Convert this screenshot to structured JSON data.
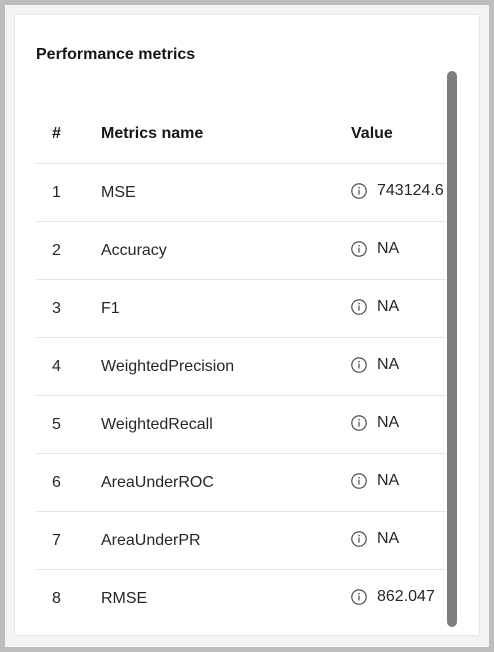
{
  "card": {
    "title": "Performance metrics"
  },
  "table": {
    "headers": {
      "number": "#",
      "name": "Metrics name",
      "value": "Value"
    },
    "rows": [
      {
        "number": "1",
        "name": "MSE",
        "value": "743124.6"
      },
      {
        "number": "2",
        "name": "Accuracy",
        "value": "NA"
      },
      {
        "number": "3",
        "name": "F1",
        "value": "NA"
      },
      {
        "number": "4",
        "name": "WeightedPrecision",
        "value": "NA"
      },
      {
        "number": "5",
        "name": "WeightedRecall",
        "value": "NA"
      },
      {
        "number": "6",
        "name": "AreaUnderROC",
        "value": "NA"
      },
      {
        "number": "7",
        "name": "AreaUnderPR",
        "value": "NA"
      },
      {
        "number": "8",
        "name": "RMSE",
        "value": "862.047"
      }
    ],
    "value_icon": "info-icon"
  },
  "colors": {
    "background": "#f4f4f4",
    "card": "#ffffff",
    "divider": "#e5e5e5",
    "scrollbar": "#7d7d7d",
    "text": "#161616"
  }
}
